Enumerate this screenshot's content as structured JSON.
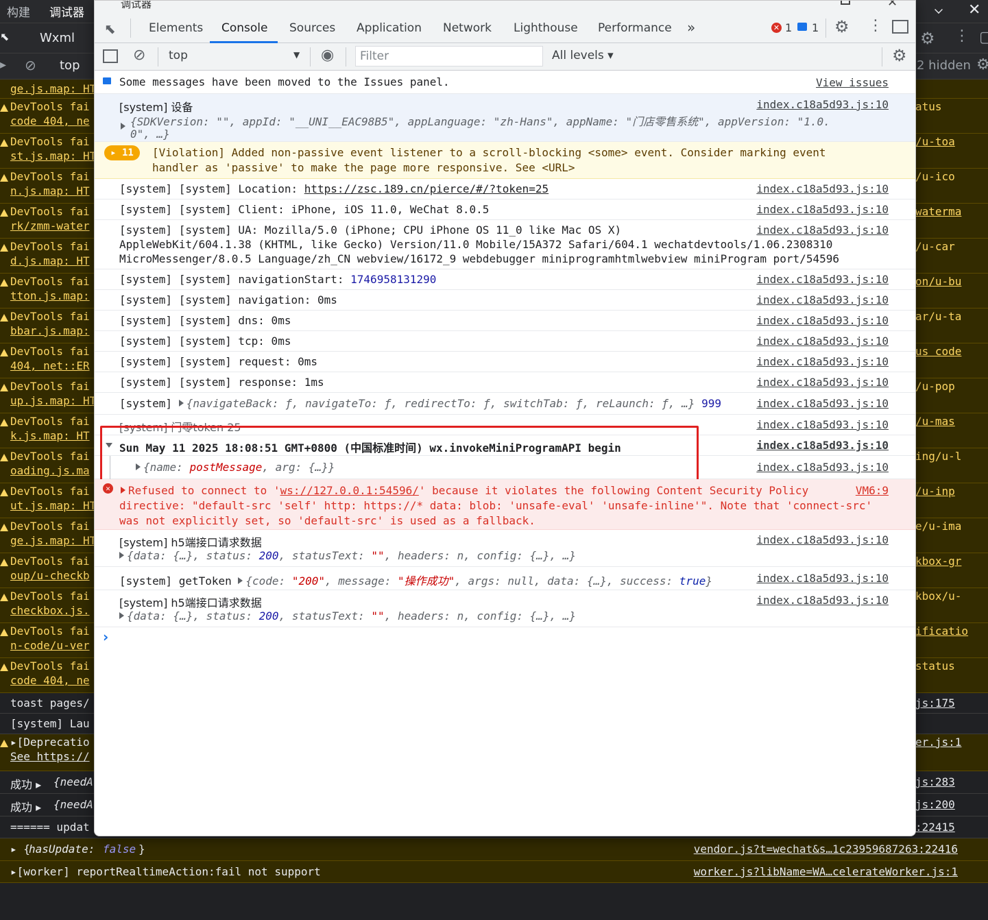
{
  "background": {
    "tabs": [
      "构建",
      "调试器"
    ],
    "wxml_tab": "Wxml",
    "context": "top",
    "hidden_count": "2 hidden",
    "rows": [
      {
        "l1": "ge.js.map: HT",
        "right": ""
      },
      {
        "l1": "DevTools fai",
        "l2": "code 404, ne",
        "right": "atus"
      },
      {
        "l1": "DevTools fai",
        "l2": "st.js.map: HT",
        "right": "/u-toa"
      },
      {
        "l1": "DevTools fai",
        "l2": "n.js.map: HT",
        "right": "/u-ico"
      },
      {
        "l1": "DevTools fai",
        "l2": "rk/zmm-water",
        "right": "waterma"
      },
      {
        "l1": "DevTools fai",
        "l2": "d.js.map: HT",
        "right": "/u-car"
      },
      {
        "l1": "DevTools fai",
        "l2": "tton.js.map:",
        "right": "on/u-bu"
      },
      {
        "l1": "DevTools fai",
        "l2": "bbar.js.map:",
        "right": "ar/u-ta"
      },
      {
        "l1": "DevTools fai",
        "l2": "404, net::ER",
        "right": "us code"
      },
      {
        "l1": "DevTools fai",
        "l2": "up.js.map: HT",
        "right": "/u-pop"
      },
      {
        "l1": "DevTools fai",
        "l2": "k.js.map: HT",
        "right": "/u-mas"
      },
      {
        "l1": "DevTools fai",
        "l2": "oading.js.ma",
        "right": "ing/u-l"
      },
      {
        "l1": "DevTools fai",
        "l2": "ut.js.map: HT",
        "right": "/u-inp"
      },
      {
        "l1": "DevTools fai",
        "l2": "ge.js.map: HT",
        "right": "e/u-ima"
      },
      {
        "l1": "DevTools fai",
        "l2": "oup/u-checkb",
        "right": "kbox-gr"
      },
      {
        "l1": "DevTools fai",
        "l2": "checkbox.js.",
        "right": "kbox/u-"
      },
      {
        "l1": "DevTools fai",
        "l2": "n-code/u-ver",
        "right": "ificatio"
      },
      {
        "l1": "DevTools fai",
        "l2": "code 404, ne",
        "right": "status"
      }
    ],
    "plain_rows": [
      {
        "text": "toast pages/",
        "right": "js:175"
      },
      {
        "text": "[system] Lau",
        "right": ""
      }
    ],
    "deprecation": {
      "l1": "[Deprecatio",
      "l2": "See https://",
      "right": "er.js:1"
    },
    "success_rows": [
      {
        "label": "成功",
        "obj": "{needA",
        "right": "js:283"
      },
      {
        "label": "成功",
        "obj": "{needA",
        "right": "js:200"
      }
    ],
    "update_row": {
      "text": "====== updat",
      "right": ":22415"
    },
    "has_update_row": {
      "key": "hasUpdate",
      "val": "false",
      "src": "vendor.js?t=wechat&s…1c23959687263:22416"
    },
    "worker_row": {
      "text": "[worker] reportRealtimeAction:fail not support",
      "src": "worker.js?libName=WA…celerateWorker.js:1"
    }
  },
  "window": {
    "title": "调试器",
    "tabs": [
      "Elements",
      "Console",
      "Sources",
      "Application",
      "Network",
      "Lighthouse",
      "Performance"
    ],
    "more": "»",
    "error_count": "1",
    "issue_count": "1",
    "context": "top",
    "filter_placeholder": "Filter",
    "levels": "All levels ▾",
    "colors": {
      "accent": "#1a73e8",
      "error": "#d93025",
      "warning_badge": "#f5a700",
      "highlight_box": "#e02020"
    }
  },
  "console": {
    "issues_msg": "Some messages have been moved to the Issues panel.",
    "view_issues": "View issues",
    "src": "index.c18a5d93.js:10",
    "sdk": {
      "prefix": "[system] 设备",
      "line": "{SDKVersion: \"\", appId: \"__UNI__EAC98B5\", appLanguage: \"zh-Hans\", appName: \"门店零售系统\", appVersion: \"1.0.",
      "cont": "0\", …}"
    },
    "violation": {
      "count": "11",
      "l1": "[Violation] Added non-passive event listener to a scroll-blocking <some> event. Consider marking event",
      "l2": "handler as 'passive' to make the page more responsive. See <URL>"
    },
    "location": {
      "prefix": "[system] [system] Location: ",
      "url": "https://zsc.189.cn/pierce/#/?token=25"
    },
    "client": "[system] [system] Client: iPhone, iOS 11.0, WeChat 8.0.5",
    "ua": [
      "[system] [system] UA: Mozilla/5.0 (iPhone; CPU iPhone OS 11_0 like Mac OS X)",
      "AppleWebKit/604.1.38 (KHTML, like Gecko) Version/11.0 Mobile/15A372 Safari/604.1 wechatdevtools/1.06.2308310",
      "MicroMessenger/8.0.5 Language/zh_CN webview/16172_9 webdebugger miniprogramhtmlwebview miniProgram port/54596"
    ],
    "nav_start": {
      "prefix": "[system] [system] navigationStart: ",
      "value": "1746958131290"
    },
    "timings": [
      "[system] [system] navigation: 0ms",
      "[system] [system] dns: 0ms",
      "[system] [system] tcp: 0ms",
      "[system] [system] request: 0ms",
      "[system] [system] response: 1ms"
    ],
    "nav_api": {
      "prefix": "[system] ",
      "obj": "{navigateBack: ƒ, navigateTo: ƒ, redirectTo: ƒ, switchTab: ƒ, reLaunch: ƒ, …}",
      "num": "999"
    },
    "token_row": "[system] 门零token 25",
    "invoke": {
      "l1": "Sun May 11 2025 18:08:51 GMT+0800 (中国标准时间) wx.invokeMiniProgramAPI begin",
      "name": "postMessage",
      "arg": "{…}"
    },
    "csp_error": {
      "l1a": "Refused to connect to '",
      "ws": "ws://127.0.0.1:54596/",
      "l1b": "' because it violates the following Content Security Policy",
      "l2": "directive: \"default-src 'self' http: https://* data: blob: 'unsafe-eval' 'unsafe-inline'\". Note that 'connect-src'",
      "l3": "was not explicitly set, so 'default-src' is used as a fallback.",
      "src": "VM6:9"
    },
    "h5_1": {
      "prefix": "[system] h5端接口请求数据",
      "status": "200"
    },
    "get_token": {
      "prefix": "[system] getToken ",
      "code": "200",
      "message": "操作成功",
      "success": "true"
    },
    "h5_2": {
      "prefix": "[system] h5端接口请求数据",
      "status": "200"
    },
    "prompt": "›"
  }
}
